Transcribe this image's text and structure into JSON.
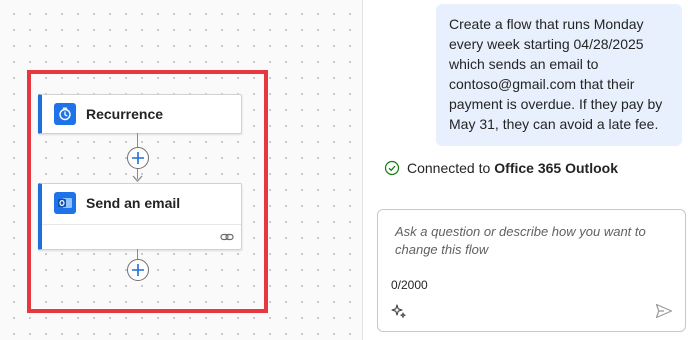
{
  "flow": {
    "nodes": [
      {
        "title": "Recurrence",
        "icon": "clock-icon"
      },
      {
        "title": "Send an email",
        "icon": "outlook-icon"
      }
    ]
  },
  "chat": {
    "user_message_lines": [
      "Create a flow that runs Monday",
      "every week starting 04/28/2025",
      "which sends an email to",
      "contoso@gmail.com that their",
      "payment is overdue. If they pay by",
      "May 31, they can avoid a late fee."
    ],
    "status_prefix": "Connected to",
    "status_service": "Office 365 Outlook"
  },
  "input": {
    "placeholder": "Ask a question or describe how you want to change this flow",
    "counter": "0/2000"
  },
  "colors": {
    "highlight": "#e5383f",
    "accent": "#1f6fd9",
    "bubble": "#e8f0fd",
    "success": "#107c10"
  }
}
